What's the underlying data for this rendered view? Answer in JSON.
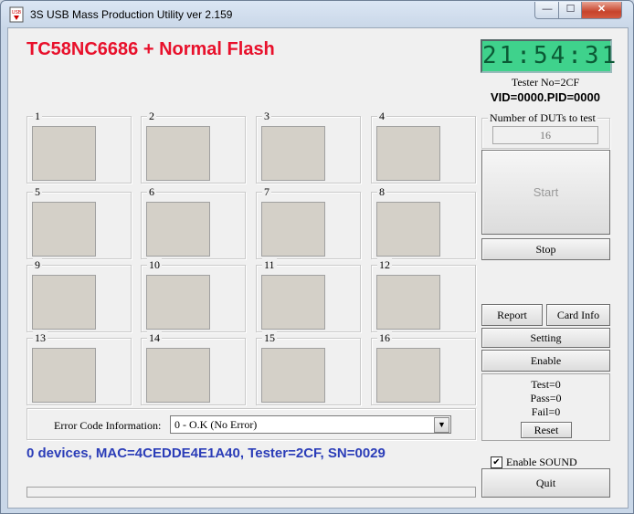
{
  "window": {
    "title": "3S USB Mass Production Utility ver 2.159",
    "app_icon_text": "USB",
    "controls": {
      "minimize": "—",
      "maximize": "☐",
      "close": "✕"
    }
  },
  "header": {
    "title": "TC58NC6686 + Normal Flash",
    "clock": "21:54:31",
    "tester_no": "Tester No=2CF",
    "vid_pid": "VID=0000.PID=0000"
  },
  "duts": {
    "label": "Number of DUTs to test",
    "value": "16"
  },
  "slots": [
    "1",
    "2",
    "3",
    "4",
    "5",
    "6",
    "7",
    "8",
    "9",
    "10",
    "11",
    "12",
    "13",
    "14",
    "15",
    "16"
  ],
  "buttons": {
    "start": "Start",
    "stop": "Stop",
    "report": "Report",
    "card_info": "Card Info",
    "setting": "Setting",
    "enable": "Enable",
    "reset": "Reset",
    "quit": "Quit"
  },
  "stats": {
    "test": "Test=0",
    "pass": "Pass=0",
    "fail": "Fail=0"
  },
  "error_code": {
    "label": "Error Code Information:",
    "selected": "0 -    O.K (No Error)"
  },
  "status_line": "0 devices, MAC=4CEDDE4E1A40, Tester=2CF, SN=0029",
  "sound": {
    "label": "Enable SOUND",
    "checked": true
  },
  "colors": {
    "title_red": "#e8102b",
    "status_blue": "#2b3db8",
    "clock_green": "#3fd28c"
  }
}
